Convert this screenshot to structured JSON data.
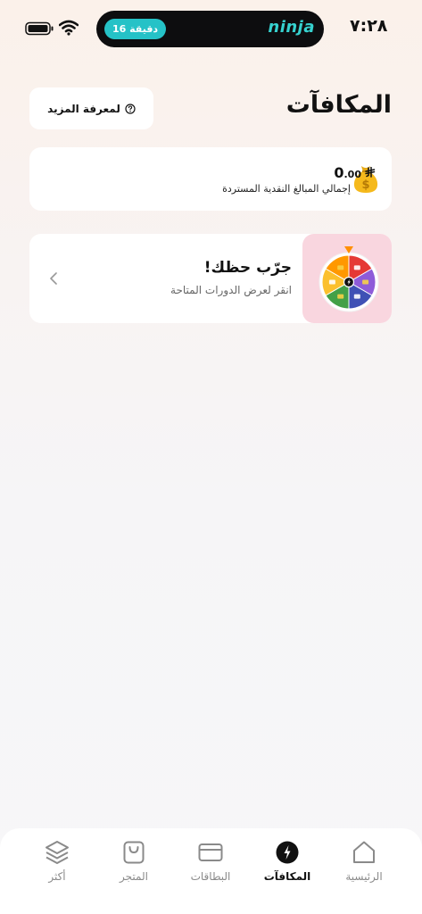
{
  "status_bar": {
    "time": "٧:٢٨",
    "timer_label": "16 دقيقة",
    "island_brand": "ninja"
  },
  "header": {
    "title": "المكافآت",
    "learn_more_label": "لمعرفة المزيد",
    "learn_more_icon": "question-circle-icon"
  },
  "cashback": {
    "amount_int": "0",
    "amount_dec": ".00",
    "currency_symbol": "⃁",
    "label": "إجمالي المبالغ النقدية المستردة",
    "icon": "money-bag-icon"
  },
  "spin": {
    "title": "جرّب حظك!",
    "subtitle": "انقر لعرض الدورات المتاحة",
    "icon": "spin-wheel-icon",
    "wheel_colors": [
      "#e53935",
      "#8e5bd9",
      "#3f51b5",
      "#43a047",
      "#fbc02d",
      "#ff9800"
    ]
  },
  "bottom_nav": {
    "items": [
      {
        "label": "الرئيسية",
        "icon": "home-icon"
      },
      {
        "label": "المكافآت",
        "icon": "rewards-icon"
      },
      {
        "label": "البطاقات",
        "icon": "card-icon"
      },
      {
        "label": "المتجر",
        "icon": "shopping-bag-icon"
      },
      {
        "label": "أكثر",
        "icon": "layers-icon"
      }
    ],
    "active_index": 1
  },
  "colors": {
    "accent_teal": "#25c2c7",
    "active_nav": "#111111",
    "inactive_nav": "#8a8a8a"
  }
}
